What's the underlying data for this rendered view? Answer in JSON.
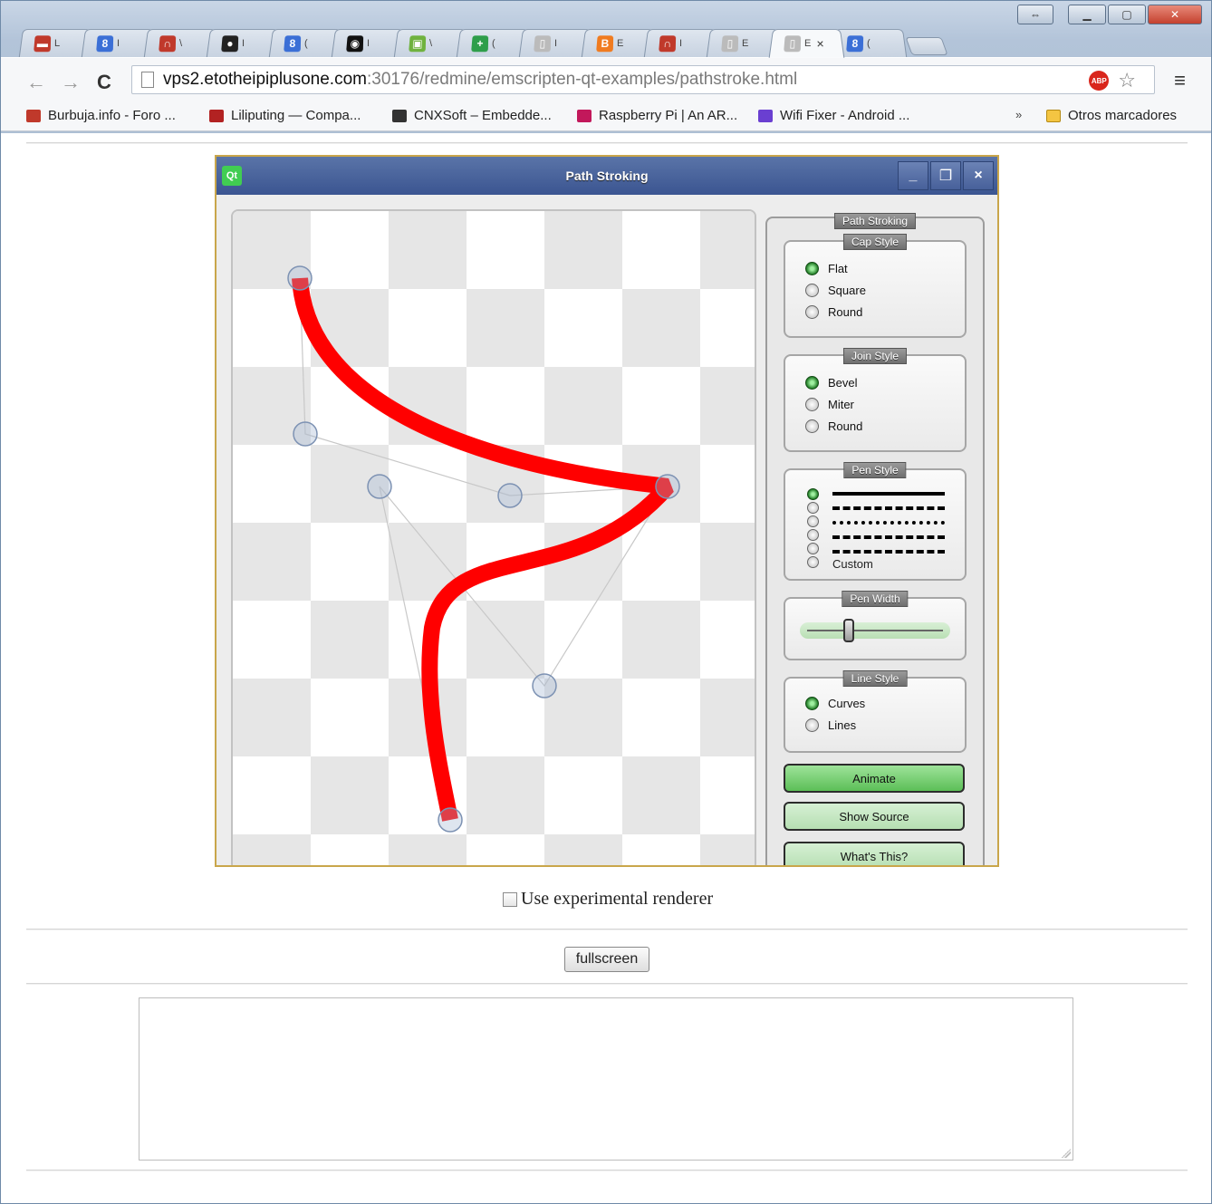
{
  "browser": {
    "tabs": [
      {
        "icon": "laptop-icon",
        "color": "#c0392b",
        "glyph": "▬",
        "label": "L"
      },
      {
        "icon": "google-plus-icon",
        "color": "#3b6fd6",
        "glyph": "8",
        "label": "I"
      },
      {
        "icon": "arc-icon",
        "color": "#c0392b",
        "glyph": "∩",
        "label": "\\"
      },
      {
        "icon": "github-icon",
        "color": "#222222",
        "glyph": "●",
        "label": "I"
      },
      {
        "icon": "google-plus-icon",
        "color": "#3b6fd6",
        "glyph": "8",
        "label": "("
      },
      {
        "icon": "github-icon",
        "color": "#111111",
        "glyph": "◉",
        "label": "I"
      },
      {
        "icon": "android-icon",
        "color": "#6fb23e",
        "glyph": "▣",
        "label": "\\"
      },
      {
        "icon": "plus-box-icon",
        "color": "#2e9e4a",
        "glyph": "+",
        "label": "("
      },
      {
        "icon": "page-icon",
        "color": "#bbbbbb",
        "glyph": "▯",
        "label": "I"
      },
      {
        "icon": "blogger-icon",
        "color": "#f07b1f",
        "glyph": "B",
        "label": "E"
      },
      {
        "icon": "arc-icon",
        "color": "#c0392b",
        "glyph": "∩",
        "label": "I"
      },
      {
        "icon": "page-icon",
        "color": "#bbbbbb",
        "glyph": "▯",
        "label": "E"
      },
      {
        "icon": "page-icon",
        "color": "#bbbbbb",
        "glyph": "▯",
        "label": "E",
        "active": true,
        "close": "×"
      },
      {
        "icon": "google-plus-icon",
        "color": "#3b6fd6",
        "glyph": "8",
        "label": "("
      }
    ],
    "nav": {
      "back": "←",
      "forward": "→",
      "reload": "C"
    },
    "url_host": "vps2.etotheipiplusone.com",
    "url_path": ":30176/redmine/emscripten-qt-examples/pathstroke.html",
    "adblock_label": "ABP",
    "star_glyph": "☆",
    "menu_glyph": "≡",
    "bookmarks": [
      {
        "label": "Burbuja.info - Foro ...",
        "icon": "burbuja-icon",
        "color": "#c0392b"
      },
      {
        "label": "Liliputing — Compa...",
        "icon": "laptop-icon",
        "color": "#b22222"
      },
      {
        "label": "CNXSoft – Embedde...",
        "icon": "cnx-icon",
        "color": "#333333"
      },
      {
        "label": "Raspberry Pi | An AR...",
        "icon": "raspberry-icon",
        "color": "#c2185b"
      },
      {
        "label": "Wifi Fixer - Android ...",
        "icon": "play-store-icon",
        "color": "#6a3fd1"
      }
    ],
    "bookmarks_more": "»",
    "other_bookmarks": "Otros marcadores"
  },
  "qt": {
    "logo": "Qt",
    "title": "Path Stroking",
    "controls": {
      "minimize": "_",
      "restore": "❐",
      "close": "×"
    },
    "panel_title": "Path Stroking",
    "cap_style": {
      "title": "Cap Style",
      "options": [
        "Flat",
        "Square",
        "Round"
      ],
      "selected": "Flat"
    },
    "join_style": {
      "title": "Join Style",
      "options": [
        "Bevel",
        "Miter",
        "Round"
      ],
      "selected": "Bevel"
    },
    "pen_style": {
      "title": "Pen Style",
      "custom_label": "Custom",
      "selected_index": 0
    },
    "pen_width": {
      "title": "Pen Width",
      "value": 0.33
    },
    "line_style": {
      "title": "Line Style",
      "options": [
        "Curves",
        "Lines"
      ],
      "selected": "Curves"
    },
    "buttons": {
      "animate": "Animate",
      "show_source": "Show Source",
      "whats_this": "What's This?"
    },
    "stroke_color": "#ff0000"
  },
  "page": {
    "experimental_label": "Use experimental renderer",
    "fullscreen_label": "fullscreen"
  }
}
